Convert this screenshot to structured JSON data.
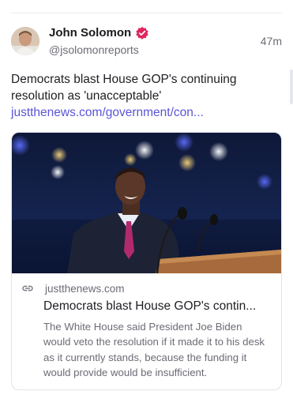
{
  "post": {
    "author_name": "John Solomon",
    "author_handle": "@jsolomonreports",
    "timestamp": "47m",
    "text": "Democrats blast House GOP's continuing resolution as 'unacceptable'",
    "link_text": "justthenews.com/government/con...",
    "icons": {
      "verified": "verified-badge-icon",
      "link": "link-icon"
    },
    "colors": {
      "link": "#5a55d6",
      "verified": "#e0245e"
    }
  },
  "card": {
    "domain": "justthenews.com",
    "title": "Democrats blast House GOP's contin...",
    "description": "The White House said President Joe Biden would veto the resolution if it made it to his desk as it currently stands, because the funding it would provide would be insufficient."
  }
}
